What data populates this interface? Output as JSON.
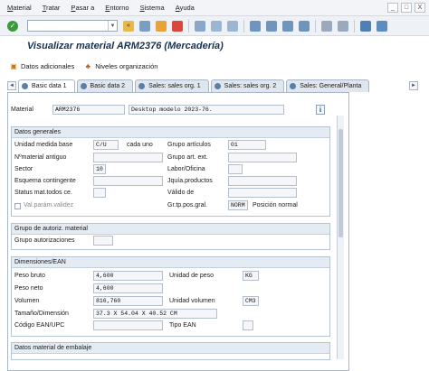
{
  "menu": [
    "Material",
    "Tratar",
    "Pasar a",
    "Entorno",
    "Sistema",
    "Ayuda"
  ],
  "window_controls": [
    "_",
    "□",
    "X"
  ],
  "toolbar": {
    "command_value": "",
    "dropdown_arrow": "▼",
    "confirm_symbol": "✓",
    "back_arrow": "«"
  },
  "page_title": "Visualizar material ARM2376 (Mercadería)",
  "app_toolbar": {
    "additional_data": "Datos adicionales",
    "org_levels": "Niveles organización"
  },
  "tabs": [
    {
      "label": "Basic data 1",
      "active": true
    },
    {
      "label": "Basic data 2",
      "active": false
    },
    {
      "label": "Sales: sales org. 1",
      "active": false
    },
    {
      "label": "Sales: sales org. 2",
      "active": false
    },
    {
      "label": "Sales: General/Planta",
      "active": false
    }
  ],
  "tab_scroll": {
    "prev": "◄",
    "next": "►"
  },
  "material": {
    "label": "Material",
    "value": "ARM2376",
    "description": "Desktop modelo 2023-76.",
    "info_symbol": "i"
  },
  "datos_generales": {
    "title": "Datos generales",
    "unidad_medida_base": {
      "label": "Unidad medida base",
      "value": "C/U",
      "suffix": "cada uno"
    },
    "grupo_articulos": {
      "label": "Grupo artículos",
      "value": "01"
    },
    "material_antiguo": {
      "label": "Nºmaterial antiguo",
      "value": ""
    },
    "grupo_art_ext": {
      "label": "Grupo art. ext.",
      "value": ""
    },
    "sector": {
      "label": "Sector",
      "value": "10"
    },
    "labor_oficina": {
      "label": "Labor/Oficina",
      "value": ""
    },
    "esquema_contingente": {
      "label": "Esquema contingente",
      "value": ""
    },
    "jquia_productos": {
      "label": "Jquía.productos",
      "value": ""
    },
    "status_mat": {
      "label": "Status mat.todos ce.",
      "value": ""
    },
    "valido_de": {
      "label": "Válido de",
      "value": ""
    },
    "val_param": {
      "label": "Val.parám.validez"
    },
    "gr_tp_pos": {
      "label": "Gr.tp.pos.gral.",
      "value": "NORM",
      "suffix": "Posición normal"
    }
  },
  "grupo_autoriz": {
    "title": "Grupo de autoriz. material",
    "grupo_autorizaciones": {
      "label": "Grupo autorizaciones",
      "value": ""
    }
  },
  "dimensiones": {
    "title": "Dimensiones/EAN",
    "peso_bruto": {
      "label": "Peso bruto",
      "value": "4,600"
    },
    "unidad_peso": {
      "label": "Unidad de peso",
      "value": "KG"
    },
    "peso_neto": {
      "label": "Peso neto",
      "value": "4,600"
    },
    "volumen": {
      "label": "Volumen",
      "value": "816,760"
    },
    "unidad_volumen": {
      "label": "Unidad volumen",
      "value": "CM3"
    },
    "tamano": {
      "label": "Tamaño/Dimensión",
      "value": "37.3 X 54.04 X 40.52 CM"
    },
    "ean_upc": {
      "label": "Código EAN/UPC",
      "value": ""
    },
    "tipo_ean": {
      "label": "Tipo EAN",
      "value": ""
    }
  },
  "embalaje": {
    "title": "Datos material de embalaje"
  },
  "colors": {
    "title": "#16324f",
    "group_header": "#e4ebf3",
    "border": "#a9b6c5",
    "confirm": "#3c9a3c"
  }
}
